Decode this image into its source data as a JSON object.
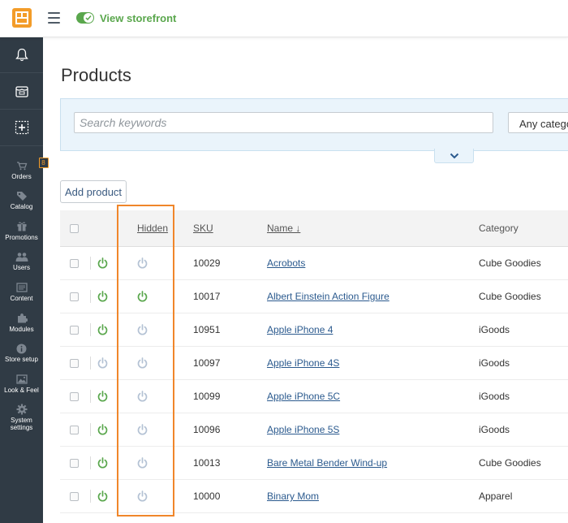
{
  "topbar": {
    "storefront_label": "View storefront"
  },
  "sidebar": {
    "top_icons": [
      "bell-icon",
      "store-icon",
      "add-icon"
    ],
    "items": [
      {
        "label": "Orders",
        "icon": "orders-icon",
        "badge": "8"
      },
      {
        "label": "Catalog",
        "icon": "tag-icon"
      },
      {
        "label": "Promotions",
        "icon": "gift-icon"
      },
      {
        "label": "Users",
        "icon": "users-icon"
      },
      {
        "label": "Content",
        "icon": "content-icon"
      },
      {
        "label": "Modules",
        "icon": "puzzle-icon"
      },
      {
        "label": "Store setup",
        "icon": "info-icon"
      },
      {
        "label": "Look & Feel",
        "icon": "image-icon"
      },
      {
        "label_line1": "System",
        "label_line2": "settings",
        "icon": "gear-icon"
      }
    ]
  },
  "main": {
    "title": "Products",
    "search": {
      "placeholder": "Search keywords",
      "category_select_value": "Any categor"
    },
    "add_product_label": "Add product"
  },
  "table": {
    "headers": {
      "hidden": "Hidden",
      "sku": "SKU",
      "name": "Name ↓",
      "category": "Category"
    },
    "rows": [
      {
        "sku": "10029",
        "name": "Acrobots",
        "category": "Cube Goodies",
        "enabled": true,
        "hidden_active": false
      },
      {
        "sku": "10017",
        "name": "Albert Einstein Action Figure",
        "category": "Cube Goodies",
        "enabled": true,
        "hidden_active": true
      },
      {
        "sku": "10951",
        "name": "Apple iPhone 4",
        "category": "iGoods",
        "enabled": true,
        "hidden_active": false
      },
      {
        "sku": "10097",
        "name": "Apple iPhone 4S",
        "category": "iGoods",
        "enabled": false,
        "hidden_active": false
      },
      {
        "sku": "10099",
        "name": "Apple iPhone 5C",
        "category": "iGoods",
        "enabled": true,
        "hidden_active": false
      },
      {
        "sku": "10096",
        "name": "Apple iPhone 5S",
        "category": "iGoods",
        "enabled": true,
        "hidden_active": false
      },
      {
        "sku": "10013",
        "name": "Bare Metal Bender Wind-up",
        "category": "Cube Goodies",
        "enabled": true,
        "hidden_active": false
      },
      {
        "sku": "10000",
        "name": "Binary Mom",
        "category": "Apparel",
        "enabled": true,
        "hidden_active": false
      }
    ]
  },
  "colors": {
    "accent_orange": "#f39c29",
    "power_on_green": "#5aa74d",
    "power_off_gray": "#b4c2d4",
    "link_blue": "#2b5a8e",
    "sidebar_bg": "#303b45"
  }
}
